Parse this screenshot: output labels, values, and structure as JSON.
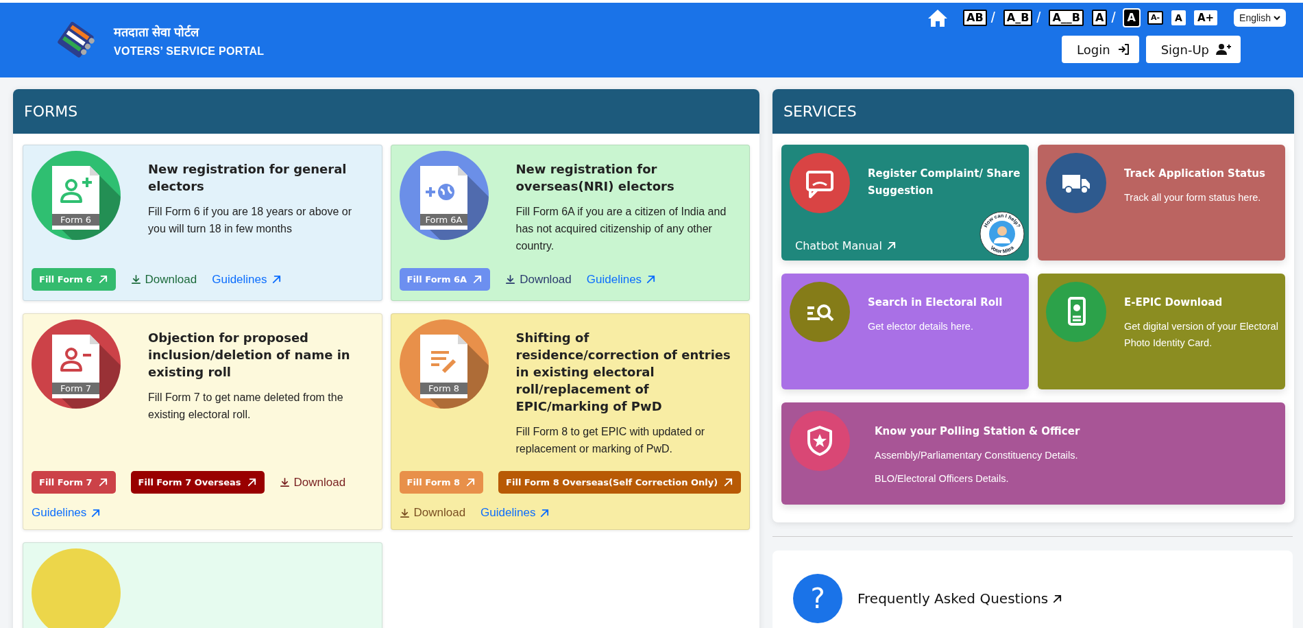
{
  "header": {
    "title_hindi": "मतदाता सेवा पोर्टल",
    "title_english": "VOTERS’ SERVICE PORTAL",
    "tools": [
      {
        "kind": "spacing",
        "label": "AB"
      },
      {
        "kind": "separator",
        "label": "/"
      },
      {
        "kind": "spacing",
        "label": "A_B"
      },
      {
        "kind": "separator",
        "label": "/"
      },
      {
        "kind": "spacing",
        "label": "A__B"
      },
      {
        "kind": "contrast-light",
        "label": "A"
      },
      {
        "kind": "separator",
        "label": "/"
      },
      {
        "kind": "contrast-dark",
        "label": "A"
      },
      {
        "kind": "font-decrease",
        "label": "A-"
      },
      {
        "kind": "font-reset",
        "label": "A"
      },
      {
        "kind": "font-increase",
        "label": "A+"
      }
    ],
    "language": "English",
    "buttons": [
      {
        "kind": "login",
        "label": "Login"
      },
      {
        "kind": "signup",
        "label": "Sign-Up"
      }
    ]
  },
  "forms": {
    "title": "FORMS",
    "cards": [
      {
        "color": "#e2f2fa",
        "icon": {
          "color": "#2fbf71"
        },
        "label": "Form 6",
        "title": "New registration for general electors",
        "description": "Fill Form 6 if you are 18 years or above or you will turn 18 in few months",
        "actions": [
          {
            "kind": "fill",
            "label": "Fill Form 6",
            "color": "#33bb6e"
          },
          {
            "kind": "download",
            "label": "Download",
            "color": "#1d6b3c"
          },
          {
            "kind": "guidelines",
            "label": "Guidelines"
          }
        ]
      },
      {
        "color": "#c9f5d0",
        "icon": {
          "color": "#6b8fe8"
        },
        "label": "Form 6A",
        "title": "New registration for overseas(NRI) electors",
        "description": "Fill Form 6A if you are a citizen of India and has not acquired citizenship of any other country.",
        "actions": [
          {
            "kind": "fill",
            "label": "Fill Form 6A",
            "color": "#6c8ff0"
          },
          {
            "kind": "download",
            "label": "Download",
            "color": "#2b3b6e"
          },
          {
            "kind": "guidelines",
            "label": "Guidelines"
          }
        ]
      },
      {
        "color": "#fdf9dc",
        "icon": {
          "color": "#cc4248"
        },
        "label": "Form 7",
        "title": "Objection for proposed inclusion/deletion of name in existing roll",
        "description": "Fill Form 7 to get name deleted from the existing electoral roll.",
        "actions": [
          {
            "kind": "fill",
            "label": "Fill Form 7",
            "color": "#cc4248"
          },
          {
            "kind": "fill",
            "label": "Fill Form 7 Overseas",
            "color": "#990000"
          },
          {
            "kind": "download",
            "label": "Download",
            "color": "#7a2323"
          },
          {
            "kind": "guidelines",
            "label": "Guidelines"
          }
        ]
      },
      {
        "color": "#f8eda4",
        "icon": {
          "color": "#e8904a"
        },
        "label": "Form 8",
        "title": "Shifting of residence/correction of entries in existing electoral roll/replacement of EPIC/marking of PwD",
        "description": "Fill Form 8 to get EPIC with updated or replacement or marking of PwD.",
        "actions": [
          {
            "kind": "fill",
            "label": "Fill Form 8",
            "color": "#e8904a"
          },
          {
            "kind": "fill",
            "label": "Fill Form 8 Overseas(Self Correction Only)",
            "color": "#b85a05"
          },
          {
            "kind": "download",
            "label": "Download",
            "color": "#7a4f22"
          },
          {
            "kind": "guidelines",
            "label": "Guidelines"
          }
        ]
      },
      {
        "color": "#e6fbef",
        "icon": {
          "color": "#ecd64a"
        }
      }
    ]
  },
  "services": {
    "title": "SERVICES",
    "cards": [
      {
        "color": "#1f877c",
        "icon": {
          "color": "#d94444"
        },
        "title": "Register Complaint/ Share Suggestion",
        "link": "Chatbot Manual",
        "badge": {
          "top": "How can I help?",
          "bottom": "Voter Mitra"
        }
      },
      {
        "color": "#bb6461",
        "icon": {
          "color": "#2e5a8e"
        },
        "title": "Track Application Status",
        "lines": [
          "Track all your form status here."
        ]
      },
      {
        "color": "#a970e6",
        "icon": {
          "color": "#857c18"
        },
        "title": "Search in Electoral Roll",
        "lines": [
          "Get elector details here."
        ]
      },
      {
        "color": "#8b8d21",
        "icon": {
          "color": "#2ca24a"
        },
        "title": "E-EPIC Download",
        "lines": [
          "Get digital version of your Electoral Photo Identity Card."
        ]
      },
      {
        "color": "#a85596",
        "icon": {
          "color": "#d94775"
        },
        "title": "Know your Polling Station & Officer",
        "lines": [
          "Assembly/Parliamentary Constituency Details.",
          "BLO/Electoral Officers Details."
        ],
        "wide": true
      }
    ]
  },
  "faq": {
    "icon": "?",
    "label": "Frequently Asked Questions"
  }
}
